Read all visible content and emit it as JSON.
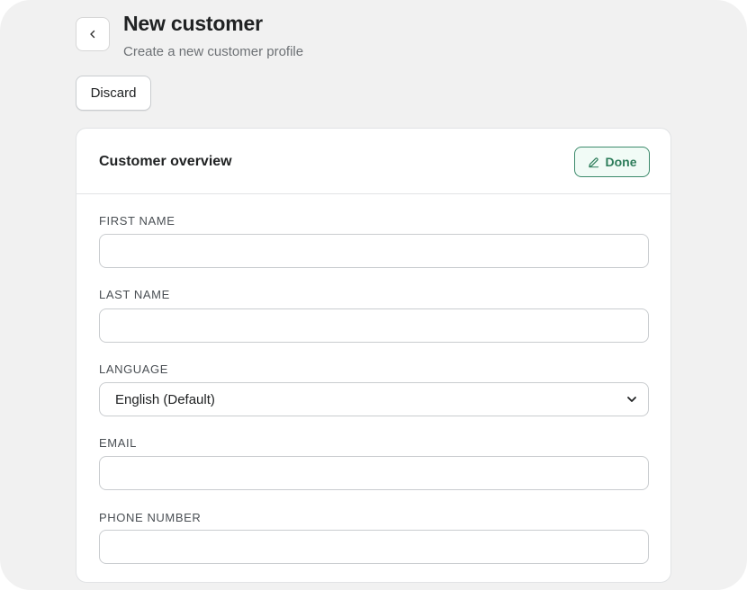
{
  "header": {
    "title": "New customer",
    "subtitle": "Create a new customer profile",
    "back_icon": "chevron-left-icon",
    "discard_label": "Discard"
  },
  "card": {
    "title": "Customer overview",
    "done_label": "Done",
    "done_icon": "pencil-icon",
    "accent_color": "#2e7d5b",
    "fields": {
      "first_name": {
        "label": "FIRST NAME",
        "value": "",
        "placeholder": ""
      },
      "last_name": {
        "label": "LAST NAME",
        "value": "",
        "placeholder": ""
      },
      "language": {
        "label": "LANGUAGE",
        "selected": "English (Default)"
      },
      "email": {
        "label": "EMAIL",
        "value": "",
        "placeholder": ""
      },
      "phone": {
        "label": "PHONE NUMBER",
        "value": "",
        "placeholder": ""
      }
    }
  }
}
